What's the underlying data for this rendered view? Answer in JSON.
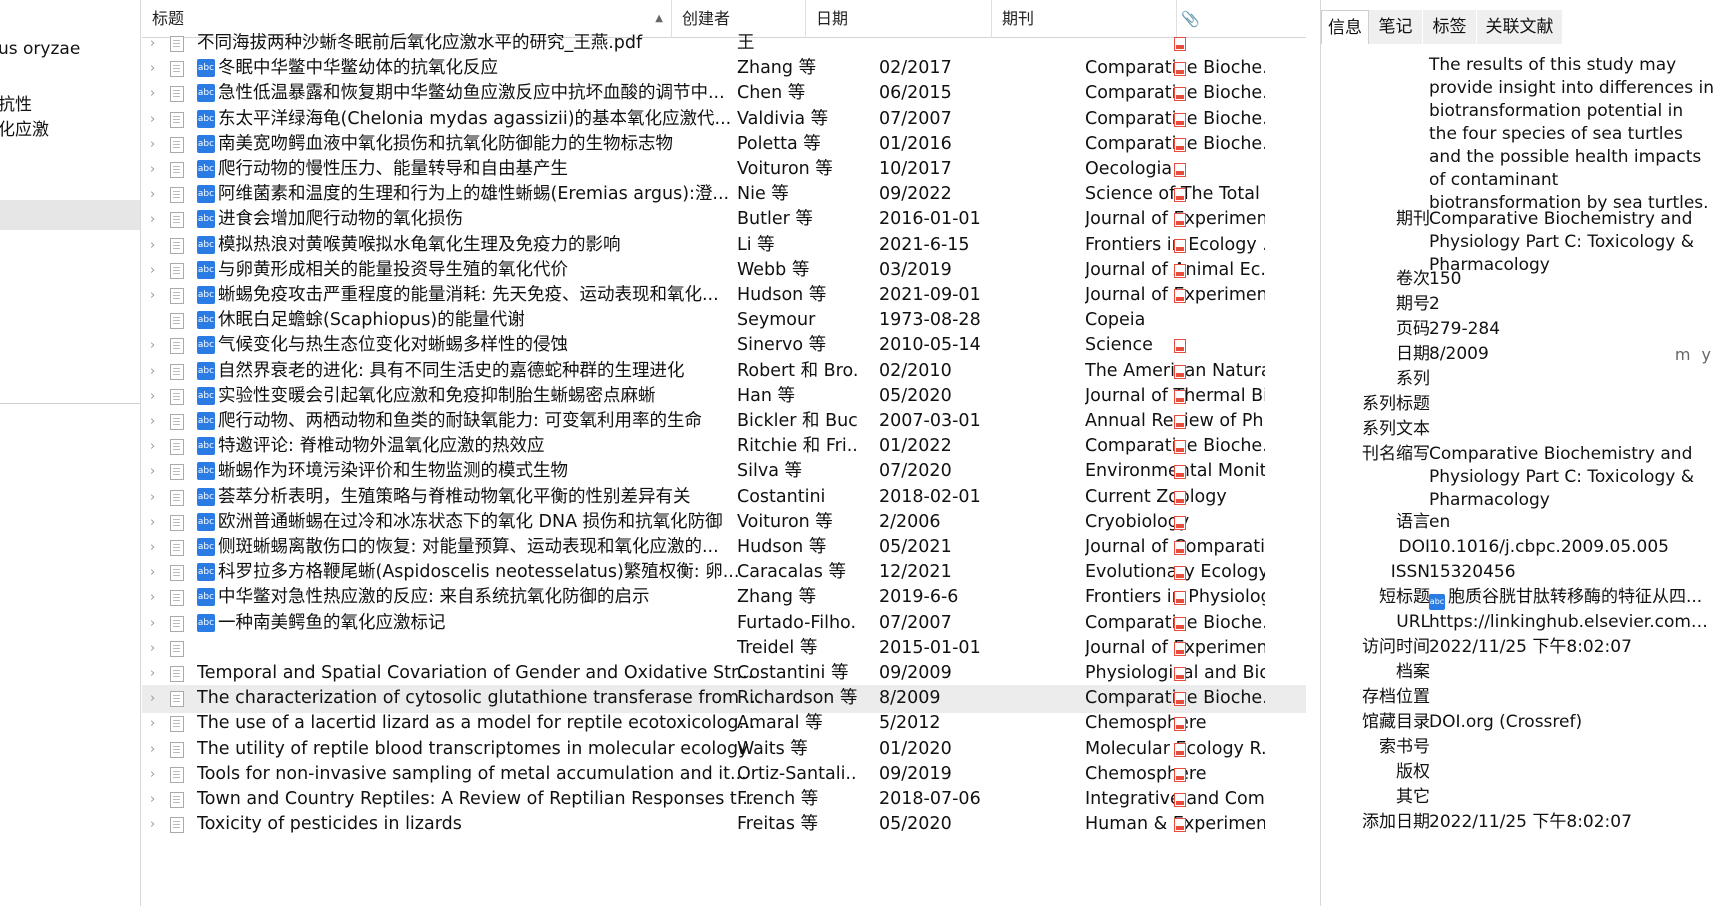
{
  "left_pane": {
    "items": [
      "us oryzae",
      "抗性",
      "化应激"
    ]
  },
  "list": {
    "columns": {
      "title": "标题",
      "creator": "创建者",
      "date": "日期",
      "publication": "期刊"
    },
    "rows": [
      {
        "title": "不同海拔两种沙蜥冬眠前后氧化应激水平的研究_王燕.pdf",
        "creator": "王",
        "date": "",
        "publication": "",
        "abc": false,
        "twisty": true,
        "pdf": true
      },
      {
        "title": "冬眠中华鳖中华鳖幼体的抗氧化反应",
        "creator": "Zhang 等",
        "date": "02/2017",
        "publication": "Comparative Bioche...",
        "abc": true,
        "twisty": true,
        "pdf": true
      },
      {
        "title": "急性低温暴露和恢复期中华鳖幼鱼应激反应中抗坏血酸的调节中...",
        "creator": "Chen 等",
        "date": "06/2015",
        "publication": "Comparative Bioche...",
        "abc": true,
        "twisty": true,
        "pdf": true
      },
      {
        "title": "东太平洋绿海龟(Chelonia mydas agassizii)的基本氧化应激代...",
        "creator": "Valdivia 等",
        "date": "07/2007",
        "publication": "Comparative Bioche...",
        "abc": true,
        "twisty": true,
        "pdf": true
      },
      {
        "title": "南美宽吻鳄血液中氧化损伤和抗氧化防御能力的生物标志物",
        "creator": "Poletta 等",
        "date": "01/2016",
        "publication": "Comparative Bioche...",
        "abc": true,
        "twisty": true,
        "pdf": true
      },
      {
        "title": "爬行动物的慢性压力、能量转导和自由基产生",
        "creator": "Voituron 等",
        "date": "10/2017",
        "publication": "Oecologia",
        "abc": true,
        "twisty": true,
        "pdf": true
      },
      {
        "title": "阿维菌素和温度的生理和行为上的雄性蜥蜴(Eremias argus):澄...",
        "creator": "Nie 等",
        "date": "09/2022",
        "publication": "Science of The Total ...",
        "abc": true,
        "twisty": true,
        "pdf": true
      },
      {
        "title": "进食会增加爬行动物的氧化损伤",
        "creator": "Butler 等",
        "date": "2016-01-01",
        "publication": "Journal of Experimen...",
        "abc": true,
        "twisty": true,
        "pdf": true
      },
      {
        "title": "模拟热浪对黄喉黄喉拟水龟氧化生理及免疫力的影响",
        "creator": "Li 等",
        "date": "2021-6-15",
        "publication": "Frontiers in Ecology ...",
        "abc": true,
        "twisty": true,
        "pdf": true
      },
      {
        "title": "与卵黄形成相关的能量投资导生殖的氧化代价",
        "creator": "Webb 等",
        "date": "03/2019",
        "publication": "Journal of Animal Ec...",
        "abc": true,
        "twisty": true,
        "pdf": true
      },
      {
        "title": "蜥蜴免疫攻击严重程度的能量消耗: 先天免疫、运动表现和氧化...",
        "creator": "Hudson 等",
        "date": "2021-09-01",
        "publication": "Journal of Experimen...",
        "abc": true,
        "twisty": true,
        "pdf": true
      },
      {
        "title": "休眠白足蟾蜍(Scaphiopus)的能量代谢",
        "creator": "Seymour",
        "date": "1973-08-28",
        "publication": "Copeia",
        "abc": true,
        "twisty": false,
        "pdf": false
      },
      {
        "title": "气候变化与热生态位变化对蜥蜴多样性的侵蚀",
        "creator": "Sinervo 等",
        "date": "2010-05-14",
        "publication": "Science",
        "abc": true,
        "twisty": true,
        "pdf": true
      },
      {
        "title": "自然界衰老的进化: 具有不同生活史的嘉德蛇种群的生理进化",
        "creator": "Robert 和 Bro...",
        "date": "02/2010",
        "publication": "The American Natura...",
        "abc": true,
        "twisty": true,
        "pdf": true
      },
      {
        "title": "实验性变暖会引起氧化应激和免疫抑制胎生蜥蜴密点麻蜥",
        "creator": "Han 等",
        "date": "05/2020",
        "publication": "Journal of Thermal Bi...",
        "abc": true,
        "twisty": true,
        "pdf": true
      },
      {
        "title": "爬行动物、两栖动物和鱼类的耐缺氧能力: 可变氧利用率的生命",
        "creator": "Bickler 和 Buck",
        "date": "2007-03-01",
        "publication": "Annual Review of Ph...",
        "abc": true,
        "twisty": true,
        "pdf": true
      },
      {
        "title": "特邀评论: 脊椎动物外温氧化应激的热效应",
        "creator": "Ritchie 和 Fri...",
        "date": "01/2022",
        "publication": "Comparative Bioche...",
        "abc": true,
        "twisty": true,
        "pdf": true
      },
      {
        "title": "蜥蜴作为环境污染评价和生物监测的模式生物",
        "creator": "Silva 等",
        "date": "07/2020",
        "publication": "Environmental Monit...",
        "abc": true,
        "twisty": true,
        "pdf": true
      },
      {
        "title": "荟萃分析表明，生殖策略与脊椎动物氧化平衡的性别差异有关",
        "creator": "Costantini",
        "date": "2018-02-01",
        "publication": "Current Zoology",
        "abc": true,
        "twisty": true,
        "pdf": true
      },
      {
        "title": "欧洲普通蜥蜴在过冷和冰冻状态下的氧化 DNA 损伤和抗氧化防御",
        "creator": "Voituron 等",
        "date": "2/2006",
        "publication": "Cryobiology",
        "abc": true,
        "twisty": true,
        "pdf": true
      },
      {
        "title": "侧斑蜥蜴离散伤口的恢复: 对能量预算、运动表现和氧化应激的...",
        "creator": "Hudson 等",
        "date": "05/2021",
        "publication": "Journal of Comparati...",
        "abc": true,
        "twisty": true,
        "pdf": true
      },
      {
        "title": "科罗拉多方格鞭尾蜥(Aspidoscelis neotesselatus)繁殖权衡: 卵...",
        "creator": "Caracalas 等",
        "date": "12/2021",
        "publication": "Evolutionary Ecology",
        "abc": true,
        "twisty": true,
        "pdf": true
      },
      {
        "title": "中华鳖对急性热应激的反应: 来自系统抗氧化防御的启示",
        "creator": "Zhang 等",
        "date": "2019-6-6",
        "publication": "Frontiers in Physiology",
        "abc": true,
        "twisty": true,
        "pdf": true
      },
      {
        "title": "一种南美鳄鱼的氧化应激标记",
        "creator": "Furtado-Filho...",
        "date": "07/2007",
        "publication": "Comparative Bioche...",
        "abc": true,
        "twisty": true,
        "pdf": true
      },
      {
        "title": "",
        "creator": "Treidel 等",
        "date": "2015-01-01",
        "publication": "Journal of Experimen...",
        "abc": false,
        "twisty": true,
        "pdf": true
      },
      {
        "title": "Temporal and Spatial Covariation of Gender and Oxidative Str...",
        "creator": "Costantini 等",
        "date": "09/2009",
        "publication": "Physiological and Bio...",
        "abc": false,
        "twisty": true,
        "pdf": true
      },
      {
        "title": "The characterization of cytosolic glutathione transferase from ...",
        "creator": "Richardson 等",
        "date": "8/2009",
        "publication": "Comparative Bioche...",
        "abc": false,
        "twisty": true,
        "pdf": true,
        "selected": true
      },
      {
        "title": "The use of a lacertid lizard as a model for reptile ecotoxicolog...",
        "creator": "Amaral 等",
        "date": "5/2012",
        "publication": "Chemosphere",
        "abc": false,
        "twisty": true,
        "pdf": true
      },
      {
        "title": "The utility of reptile blood transcriptomes in molecular ecology",
        "creator": "Waits 等",
        "date": "01/2020",
        "publication": "Molecular Ecology R...",
        "abc": false,
        "twisty": true,
        "pdf": true
      },
      {
        "title": "Tools for non-invasive sampling of metal accumulation and it...",
        "creator": "Ortiz-Santali...",
        "date": "09/2019",
        "publication": "Chemosphere",
        "abc": false,
        "twisty": true,
        "pdf": true
      },
      {
        "title": "Town and Country Reptiles: A Review of Reptilian Responses t...",
        "creator": "French 等",
        "date": "2018-07-06",
        "publication": "Integrative and Com...",
        "abc": false,
        "twisty": true,
        "pdf": true
      },
      {
        "title": "Toxicity of pesticides in lizards",
        "creator": "Freitas 等",
        "date": "05/2020",
        "publication": "Human & Experimen...",
        "abc": false,
        "twisty": true,
        "pdf": true
      }
    ]
  },
  "right_pane": {
    "tabs": [
      "信息",
      "笔记",
      "标签",
      "关联文献"
    ],
    "abstract": "The results of this study may provide insight into differences in biotransformation potential in the four species of sea turtles and the possible health impacts of contaminant biotransformation by sea turtles.",
    "fields": [
      {
        "label": "期刊",
        "value": "Comparative Biochemistry and Physiology Part C: Toxicology & Pharmacology"
      },
      {
        "label": "卷次",
        "value": "150"
      },
      {
        "label": "期号",
        "value": "2"
      },
      {
        "label": "页码",
        "value": "279-284"
      },
      {
        "label": "日期",
        "value": "8/2009",
        "hint": "m y"
      },
      {
        "label": "系列",
        "value": ""
      },
      {
        "label": "系列标题",
        "value": ""
      },
      {
        "label": "系列文本",
        "value": ""
      },
      {
        "label": "刊名缩写",
        "value": "Comparative Biochemistry and Physiology Part C: Toxicology & Pharmacology"
      },
      {
        "label": "语言",
        "value": "en"
      },
      {
        "label": "DOI",
        "value": "10.1016/j.cbpc.2009.05.005"
      },
      {
        "label": "ISSN",
        "value": "15320456"
      },
      {
        "label": "短标题",
        "value": "胞质谷胱甘肽转移酶的特征从四...",
        "abc": true
      },
      {
        "label": "URL",
        "value": "https://linkinghub.elsevier.com/r..."
      },
      {
        "label": "访问时间",
        "value": "2022/11/25 下午8:02:07"
      },
      {
        "label": "档案",
        "value": ""
      },
      {
        "label": "存档位置",
        "value": ""
      },
      {
        "label": "馆藏目录",
        "value": "DOI.org (Crossref)"
      },
      {
        "label": "索书号",
        "value": ""
      },
      {
        "label": "版权",
        "value": ""
      },
      {
        "label": "其它",
        "value": ""
      },
      {
        "label": "添加日期",
        "value": "2022/11/25 下午8:02:07"
      }
    ]
  }
}
